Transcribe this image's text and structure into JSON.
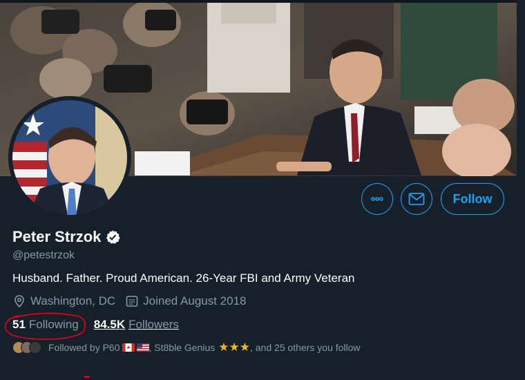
{
  "profile": {
    "name": "Peter Strzok",
    "handle": "@petestrzok",
    "bio": "Husband. Father. Proud American. 26-Year FBI and Army Veteran",
    "location": "Washington, DC",
    "joined": "Joined August 2018",
    "following_count": "51",
    "following_label": "Following",
    "followers_count": "84.5K",
    "followers_label": "Followers"
  },
  "actions": {
    "more_icon": "more-horizontal-icon",
    "message_icon": "envelope-icon",
    "follow_label": "Follow"
  },
  "followed_by": {
    "prefix": "Followed by P60",
    "second": ", St8ble Genius",
    "suffix": ", and 25 others you follow"
  },
  "colors": {
    "background": "#15202b",
    "accent": "#1da1f2",
    "muted": "#8899a6",
    "annotation": "#d9001b",
    "star": "#f5b81c"
  }
}
